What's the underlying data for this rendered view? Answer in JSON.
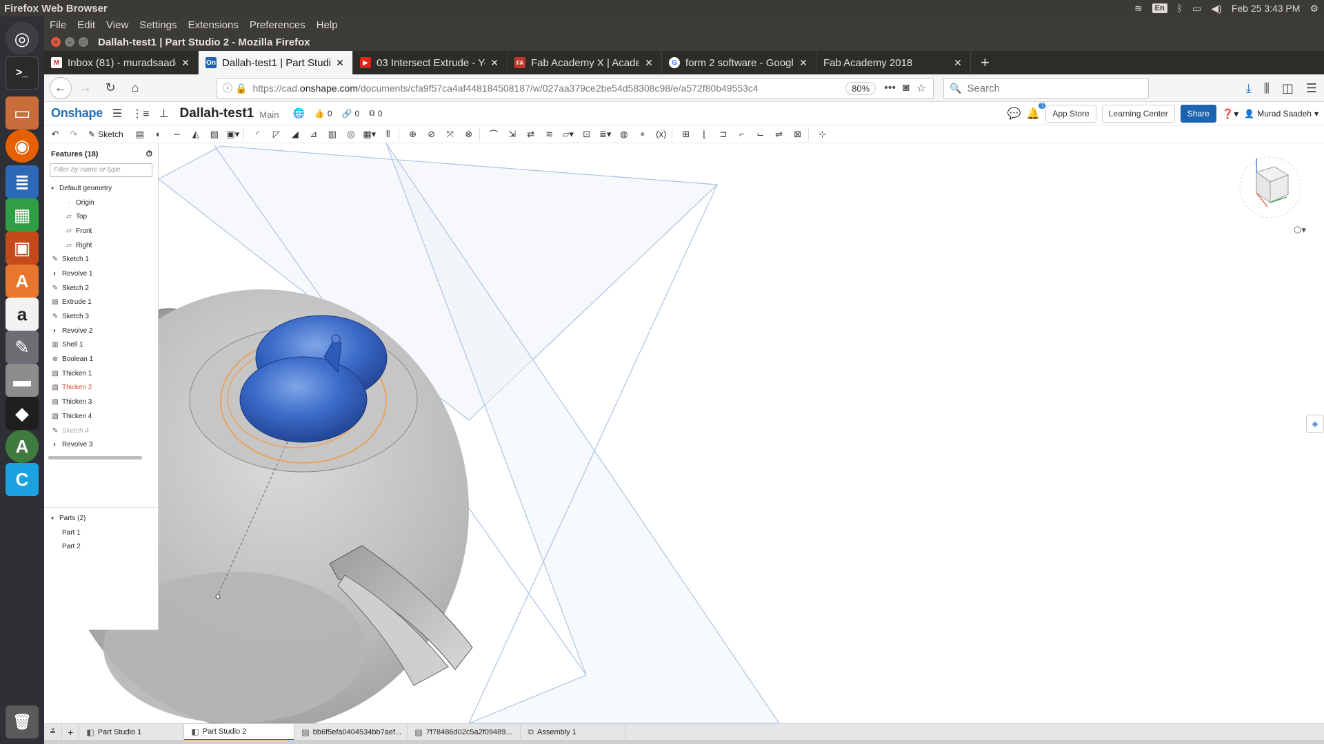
{
  "system": {
    "app_title": "Firefox Web Browser",
    "keyboard": "En",
    "datetime": "Feb 25  3:43 PM"
  },
  "launcher": {
    "items": [
      "Dash",
      "Terminal",
      "Files",
      "Firefox",
      "Writer",
      "Calc",
      "Impress",
      "Software",
      "Amazon",
      "Settings",
      "Drive",
      "Inkscape",
      "Updater",
      "Code"
    ],
    "trash": "Trash"
  },
  "firefox": {
    "menu": [
      "File",
      "Edit",
      "View",
      "Settings",
      "Extensions",
      "Preferences",
      "Help"
    ],
    "window_title": "Dallah-test1 | Part Studio 2 - Mozilla Firefox",
    "tabs": [
      {
        "label": "Inbox (81) - muradsaade",
        "favicon": "M"
      },
      {
        "label": "Dallah-test1 | Part Studi",
        "favicon": "On"
      },
      {
        "label": "03 Intersect Extrude - Yo",
        "favicon": "▶"
      },
      {
        "label": "Fab Academy X | Academ",
        "favicon": "FA"
      },
      {
        "label": "form 2 software - Googl",
        "favicon": "G"
      },
      {
        "label": "Fab Academy 2018",
        "favicon": ""
      }
    ],
    "url_prefix": "https://cad.",
    "url_domain": "onshape.com",
    "url_path": "/documents/cfa9f57ca4af448184508187/w/027aa379ce2be54d58308c98/e/a572f80b49553c4",
    "zoom": "80%",
    "search_placeholder": "Search"
  },
  "onshape": {
    "logo": "Onshape",
    "doc_title": "Dallah-test1",
    "branch": "Main",
    "likes": "0",
    "links": "0",
    "copies": "0",
    "notifications": "3",
    "app_store": "App Store",
    "learning_center": "Learning Center",
    "share": "Share",
    "user": "Murad Saadeh",
    "sketch_label": "Sketch",
    "features_title": "Features (18)",
    "filter_placeholder": "Filter by name or type",
    "default_geometry": "Default geometry",
    "geometry": [
      "Origin",
      "Top",
      "Front",
      "Right"
    ],
    "features": [
      {
        "label": "Sketch 1",
        "icon": "✎",
        "state": ""
      },
      {
        "label": "Revolve 1",
        "icon": "◐",
        "state": ""
      },
      {
        "label": "Sketch 2",
        "icon": "✎",
        "state": ""
      },
      {
        "label": "Extrude 1",
        "icon": "▤",
        "state": ""
      },
      {
        "label": "Sketch 3",
        "icon": "✎",
        "state": ""
      },
      {
        "label": "Revolve 2",
        "icon": "◐",
        "state": ""
      },
      {
        "label": "Shell 1",
        "icon": "▥",
        "state": ""
      },
      {
        "label": "Boolean 1",
        "icon": "⊕",
        "state": ""
      },
      {
        "label": "Thicken 1",
        "icon": "▧",
        "state": ""
      },
      {
        "label": "Thicken 2",
        "icon": "▧",
        "state": "red"
      },
      {
        "label": "Thicken 3",
        "icon": "▧",
        "state": ""
      },
      {
        "label": "Thicken 4",
        "icon": "▧",
        "state": ""
      },
      {
        "label": "Sketch 4",
        "icon": "✎",
        "state": "grey"
      },
      {
        "label": "Revolve 3",
        "icon": "◐",
        "state": ""
      }
    ],
    "parts_title": "Parts (2)",
    "parts": [
      "Part 1",
      "Part 2"
    ],
    "bottom_tabs": [
      {
        "label": "Part Studio 1",
        "active": false
      },
      {
        "label": "Part Studio 2",
        "active": true
      },
      {
        "label": "bb6f5efa0404534bb7aef...",
        "active": false
      },
      {
        "label": "7f78486d02c5a2f09489...",
        "active": false
      },
      {
        "label": "Assembly 1",
        "active": false
      }
    ]
  }
}
